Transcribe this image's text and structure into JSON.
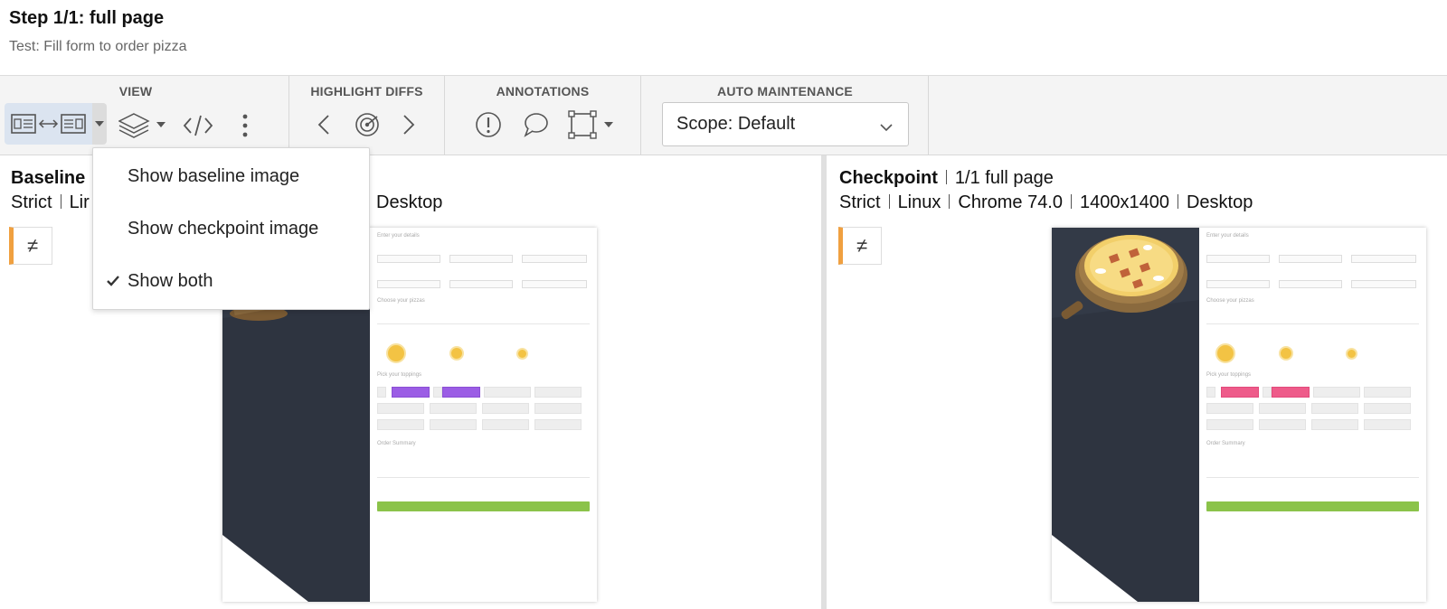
{
  "header": {
    "title": "Step 1/1: full page",
    "subtitle": "Test: Fill form to order pizza"
  },
  "toolbar": {
    "view_label": "VIEW",
    "highlight_label": "HIGHLIGHT DIFFS",
    "annotations_label": "ANNOTATIONS",
    "auto_label": "AUTO MAINTENANCE",
    "scope_value": "Scope: Default",
    "icons": [
      "split-view-icon",
      "layers-icon",
      "code-icon",
      "more-vertical-icon",
      "chevron-left-icon",
      "target-icon",
      "chevron-right-icon",
      "exclamation-icon",
      "comment-icon",
      "region-select-icon"
    ]
  },
  "menu": {
    "items": [
      {
        "label": "Show baseline image",
        "checked": false
      },
      {
        "label": "Show checkpoint image",
        "checked": false
      },
      {
        "label": "Show both",
        "checked": true
      }
    ]
  },
  "baseline": {
    "title": "Baseline",
    "meta_visible": "Strict",
    "meta_partial": "Lir",
    "meta_tail": "Desktop",
    "badge": "≠"
  },
  "checkpoint": {
    "title": "Checkpoint",
    "step": "1/1 full page",
    "meta": [
      "Strict",
      "Linux",
      "Chrome 74.0",
      "1400x1400",
      "Desktop"
    ],
    "badge": "≠"
  },
  "colors": {
    "accent_orange": "#f0a040",
    "baseline_topping": "#9b5de5",
    "checkpoint_topping": "#ee5b8a",
    "place_order": "#8bc34a"
  }
}
